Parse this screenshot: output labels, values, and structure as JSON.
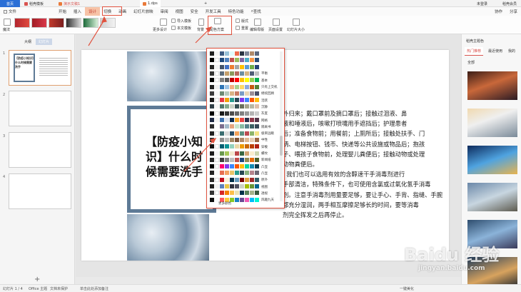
{
  "titlebar": {
    "tabs": [
      {
        "label": "首页"
      },
      {
        "label": "稻壳模板"
      },
      {
        "label": "演示文稿1"
      },
      {
        "label": "1.dps"
      }
    ],
    "user": "未登录",
    "right_label": "稻壳会员"
  },
  "menu": {
    "items": [
      "文件",
      "开始",
      "插入",
      "设计",
      "切换",
      "动画",
      "幻灯片放映",
      "审阅",
      "视图",
      "安全",
      "开发工具",
      "特色功能"
    ],
    "search": "查找",
    "right_items": [
      "协作",
      "分享"
    ]
  },
  "ribbon": {
    "magic_label": "魔法",
    "import_template": "导入模板",
    "text_template": "本文模板",
    "more_design": "更多设计",
    "color_scheme": "配色方案",
    "background": "背景",
    "bg_fill": "背景",
    "edit_master": "编辑母版",
    "slide_size": "幻灯片大小",
    "page_settings": "页面设置",
    "format": "版式",
    "reset": "重置"
  },
  "left_panel": {
    "tabs": [
      "大纲",
      "幻灯片"
    ],
    "slide_numbers": [
      "1",
      "2",
      "3",
      "4"
    ],
    "thumb_title": "【防疫小知识】什么时候需要洗手",
    "add_icon": "+"
  },
  "slide": {
    "title": "【防疫小知\n识】什么时\n候需要洗手",
    "body": "外归来；戴口罩前及摘口罩后；接触过泪液、鼻\n液和唾液后，咳嗽打喷嚏用手遮挡后；护理患者\n后；准备食物前；用餐前；上厕所后；接触处扶手、门\n柄、电梯按钮、钱币、快递等公共设施或物品后；抱孩\n子、喂孩子食物前，处理婴儿粪便后；接触动物或处理\n动物粪便后。\n  我们也可以选用有效的含醇速干手消毒剂进行\n手部清洁，特殊条件下，也可使用含氯或过氧化氢手消毒\n剂。注意手消毒剂用量要足够，要让手心、手背、指缝、手腕\n都充分湿润，两手相互摩擦足够长的时间，要等消毒\n剂完全挥发之后再停止。"
  },
  "color_scheme_dropdown": {
    "schemes": [
      {
        "name": "",
        "colors": [
          "#1f1f1f",
          "#f3f3f3",
          "#3d5a80",
          "#98c1d9",
          "#e0fbfc",
          "#ee6c4d",
          "#293241",
          "#7d8597",
          "#b08968",
          "#5c677d"
        ]
      },
      {
        "name": "",
        "colors": [
          "#000000",
          "#ffffff",
          "#1f497d",
          "#4f81bd",
          "#c0504d",
          "#9bbb59",
          "#8064a2",
          "#4bacc6",
          "#f79646",
          "#2c4d75"
        ]
      },
      {
        "name": "",
        "colors": [
          "#262626",
          "#f2f2f2",
          "#44546a",
          "#4472c4",
          "#ed7d31",
          "#a5a5a5",
          "#ffc000",
          "#5b9bd5",
          "#70ad47",
          "#264478"
        ]
      },
      {
        "name": "平衡",
        "colors": [
          "#333333",
          "#ffffff",
          "#5b6b7a",
          "#c59f6a",
          "#8a9a5b",
          "#b56b5e",
          "#6b8fa3",
          "#d4b483",
          "#4f5d75",
          "#bfc0c0"
        ]
      },
      {
        "name": "基本",
        "colors": [
          "#000000",
          "#ffffff",
          "#7f7f7f",
          "#595959",
          "#c00000",
          "#ff0000",
          "#ffc000",
          "#ffff00",
          "#92d050",
          "#00b050"
        ]
      },
      {
        "name": "只有上交机",
        "colors": [
          "#222222",
          "#eeeeee",
          "#2e75b6",
          "#9dc3e6",
          "#f4b183",
          "#a9d18e",
          "#ffd966",
          "#8faadc",
          "#c55a11",
          "#548235"
        ]
      },
      {
        "name": "继续回顾",
        "colors": [
          "#3b3b3b",
          "#f7f7f7",
          "#6d8b74",
          "#b6c9bb",
          "#d8b384",
          "#c97b63",
          "#7a9cc6",
          "#e8d5b7",
          "#9a8c98",
          "#4a4e69"
        ]
      },
      {
        "name": "活跃",
        "colors": [
          "#1a1a1a",
          "#ffffff",
          "#e63946",
          "#f1a208",
          "#2a9d8f",
          "#264653",
          "#8338ec",
          "#3a86ff",
          "#fb5607",
          "#ffbe0b"
        ]
      },
      {
        "name": "沉静",
        "colors": [
          "#2f3e46",
          "#f5f5f5",
          "#52796f",
          "#84a98c",
          "#cad2c5",
          "#354f52",
          "#6b705c",
          "#a5a58d",
          "#b7b7a4",
          "#ddbea9"
        ]
      },
      {
        "name": "灰度",
        "colors": [
          "#000000",
          "#ffffff",
          "#1a1a1a",
          "#333333",
          "#4d4d4d",
          "#666666",
          "#808080",
          "#999999",
          "#b3b3b3",
          "#cccccc"
        ]
      },
      {
        "name": "网格",
        "colors": [
          "#1f2a44",
          "#f2f2f2",
          "#3f72af",
          "#dbe2ef",
          "#112d4e",
          "#f9a826",
          "#e84545",
          "#2b2e4a",
          "#903749",
          "#53354a"
        ]
      },
      {
        "name": "隔离书",
        "colors": [
          "#2d2d2d",
          "#fefefe",
          "#7b6d8d",
          "#a3b9c9",
          "#e6a57e",
          "#c9e4ca",
          "#87bba2",
          "#55828b",
          "#3b6064",
          "#364958"
        ]
      },
      {
        "name": "极目远眺",
        "colors": [
          "#202020",
          "#ffffff",
          "#3c6e71",
          "#d9d9d9",
          "#284b63",
          "#f4a259",
          "#5b8e7d",
          "#bc4b51",
          "#8cb369",
          "#f4e285"
        ]
      },
      {
        "name": "中性",
        "colors": [
          "#333333",
          "#f8f8f8",
          "#8d8d8d",
          "#bcbcbc",
          "#a68a64",
          "#7f5539",
          "#b08968",
          "#ddb892",
          "#e6ccb2",
          "#9c6644"
        ]
      },
      {
        "name": "穿梭",
        "colors": [
          "#111111",
          "#ffffff",
          "#005f73",
          "#0a9396",
          "#94d2bd",
          "#e9d8a6",
          "#ee9b00",
          "#ca6702",
          "#bb3e03",
          "#ae2012"
        ]
      },
      {
        "name": "螺纹",
        "colors": [
          "#1b1b1b",
          "#f4f4f4",
          "#6a994e",
          "#a7c957",
          "#f2e8cf",
          "#bc4749",
          "#386641",
          "#d4a373",
          "#faedcd",
          "#ccd5ae"
        ]
      },
      {
        "name": "新闻纸",
        "colors": [
          "#262626",
          "#ffffff",
          "#404040",
          "#7f7f7f",
          "#bfbfbf",
          "#c0504d",
          "#1f497d",
          "#948a54",
          "#e46c0a",
          "#4f6228"
        ]
      },
      {
        "name": "凸显",
        "colors": [
          "#000000",
          "#ffffff",
          "#ff006e",
          "#8338ec",
          "#3a86ff",
          "#fb5607",
          "#ffbe0b",
          "#06d6a0",
          "#118ab2",
          "#073b4c"
        ]
      },
      {
        "name": "凸显",
        "colors": [
          "#222222",
          "#f9f9f9",
          "#e76f51",
          "#f4a261",
          "#e9c46a",
          "#2a9d8f",
          "#264653",
          "#8ab17d",
          "#b5838d",
          "#6d6875"
        ]
      },
      {
        "name": "原外",
        "colors": [
          "#2b2b2b",
          "#ffffff",
          "#c1121f",
          "#fdf0d5",
          "#003049",
          "#669bbc",
          "#780000",
          "#e09f3e",
          "#9e2a2b",
          "#335c67"
        ]
      },
      {
        "name": "视图",
        "colors": [
          "#1e1e1e",
          "#f0f0f0",
          "#5c80bc",
          "#e8c547",
          "#30323d",
          "#4d5061",
          "#cdd1c4",
          "#a5be00",
          "#679436",
          "#05668d"
        ]
      },
      {
        "name": "透视",
        "colors": [
          "#333333",
          "#ffffff",
          "#d62828",
          "#f77f00",
          "#fcbf49",
          "#eae2b7",
          "#003049",
          "#588157",
          "#a3b18a",
          "#3a5a40"
        ]
      },
      {
        "name": "风趣九天",
        "colors": [
          "#111111",
          "#fafafa",
          "#ff595e",
          "#ffca3a",
          "#8ac926",
          "#1982c4",
          "#6a4c93",
          "#f15bb5",
          "#00bbf9",
          "#00f5d4"
        ]
      }
    ],
    "more_colors": "更多颜色"
  },
  "right_panel": {
    "title": "稻壳主题色",
    "tabs": [
      "热门推荐",
      "最近使用",
      "我的"
    ],
    "filter": "全部"
  },
  "statusbar": {
    "slide_info": "幻灯片 1 / 4",
    "theme": "Office 主题",
    "spell": "文档未保护",
    "notes": "单击此处添加备注",
    "zoom": "一键美化"
  },
  "watermark": {
    "brand": "Baidu 经验",
    "url": "jingyan.baidu.com"
  },
  "colors": {
    "accent": "#2b6fd6",
    "highlight": "#e1533f",
    "frame": "#5e7a96"
  }
}
